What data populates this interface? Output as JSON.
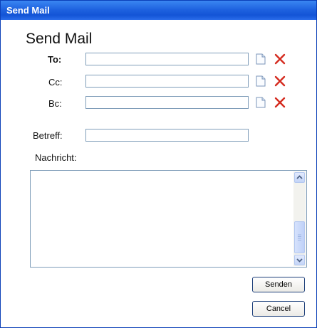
{
  "window": {
    "title": "Send Mail"
  },
  "form": {
    "heading": "Send Mail",
    "to_label": "To:",
    "cc_label": "Cc:",
    "bc_label": "Bc:",
    "subject_label": "Betreff:",
    "message_label": "Nachricht:",
    "to_value": "",
    "cc_value": "",
    "bc_value": "",
    "subject_value": ""
  },
  "icons": {
    "add": "address-book-icon",
    "remove": "close-x-icon"
  },
  "buttons": {
    "send": "Senden",
    "cancel": "Cancel"
  },
  "colors": {
    "titlebar": "#1f63e0",
    "remove_x": "#d42a1e",
    "field_border": "#7f9db9"
  }
}
